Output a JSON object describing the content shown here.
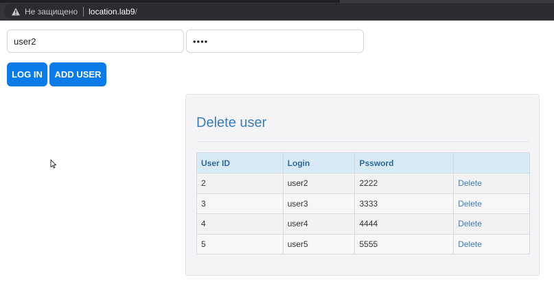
{
  "browser": {
    "security_label": "Не защищено",
    "url_host": "location.lab9",
    "url_path": "/"
  },
  "form": {
    "login_value": "user2",
    "password_value": "••••",
    "login_button": "LOG IN",
    "add_user_button": "ADD USER"
  },
  "colors": {
    "accent": "#0a7bea",
    "title": "#3a7fbd",
    "table_header_bg": "#d9eaf7"
  },
  "panel": {
    "title": "Delete user",
    "columns": [
      "User ID",
      "Login",
      "Pssword",
      ""
    ],
    "rows": [
      {
        "id": "2",
        "login": "user2",
        "password": "2222",
        "action": "Delete"
      },
      {
        "id": "3",
        "login": "user3",
        "password": "3333",
        "action": "Delete"
      },
      {
        "id": "4",
        "login": "user4",
        "password": "4444",
        "action": "Delete"
      },
      {
        "id": "5",
        "login": "user5",
        "password": "5555",
        "action": "Delete"
      }
    ]
  }
}
